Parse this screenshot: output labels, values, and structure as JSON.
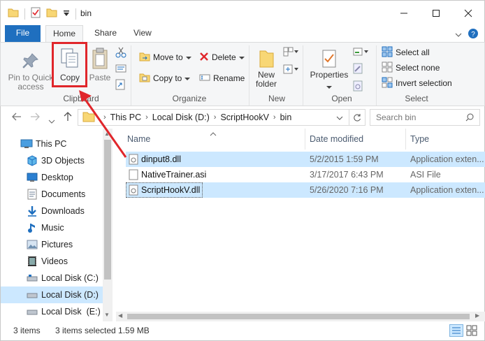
{
  "window": {
    "title": "bin",
    "minimize_icon": "minimize-icon",
    "maximize_icon": "maximize-icon",
    "close_icon": "close-icon"
  },
  "ribbon_tabs": {
    "file": "File",
    "home": "Home",
    "share": "Share",
    "view": "View"
  },
  "clipboard": {
    "pin_label": "Pin to Quick access",
    "pin_line1": "Pin to Quick",
    "pin_line2": "access",
    "copy": "Copy",
    "paste": "Paste",
    "group": "Clipboard"
  },
  "organize": {
    "move_to": "Move to",
    "copy_to": "Copy to",
    "delete": "Delete",
    "rename": "Rename",
    "group": "Organize"
  },
  "new": {
    "new_folder_line1": "New",
    "new_folder_line2": "folder",
    "group": "New"
  },
  "open": {
    "properties": "Properties",
    "group": "Open"
  },
  "select": {
    "select_all": "Select all",
    "select_none": "Select none",
    "invert_selection": "Invert selection",
    "group": "Select"
  },
  "address": {
    "crumbs": [
      "This PC",
      "Local Disk (D:)",
      "ScriptHookV",
      "bin"
    ],
    "search_placeholder": "Search bin"
  },
  "nav_pane": {
    "items": [
      {
        "label": "This PC",
        "icon": "computer-icon"
      },
      {
        "label": "3D Objects",
        "icon": "cube-icon"
      },
      {
        "label": "Desktop",
        "icon": "desktop-icon"
      },
      {
        "label": "Documents",
        "icon": "document-icon"
      },
      {
        "label": "Downloads",
        "icon": "download-icon"
      },
      {
        "label": "Music",
        "icon": "music-icon"
      },
      {
        "label": "Pictures",
        "icon": "picture-icon"
      },
      {
        "label": "Videos",
        "icon": "video-icon"
      },
      {
        "label": "Local Disk (C:)",
        "icon": "drive-icon"
      },
      {
        "label": "Local Disk (D:)",
        "icon": "drive-icon"
      },
      {
        "label": "Local Disk  (E:)",
        "icon": "drive-icon"
      }
    ]
  },
  "file_list": {
    "columns": {
      "name": "Name",
      "date": "Date modified",
      "type": "Type"
    },
    "rows": [
      {
        "name": "dinput8.dll",
        "date": "5/2/2015 1:59 PM",
        "type": "Application exten...",
        "selected": true
      },
      {
        "name": "NativeTrainer.asi",
        "date": "3/17/2017 6:43 PM",
        "type": "ASI File",
        "selected": false
      },
      {
        "name": "ScriptHookV.dll",
        "date": "5/26/2020 7:16 PM",
        "type": "Application exten...",
        "selected": true
      }
    ]
  },
  "status": {
    "item_count": "3 items",
    "selected": "3 items selected  1.59 MB"
  },
  "colors": {
    "accent": "#1f6fbf",
    "selection": "#cce8ff",
    "highlight_red": "#e0262b"
  }
}
